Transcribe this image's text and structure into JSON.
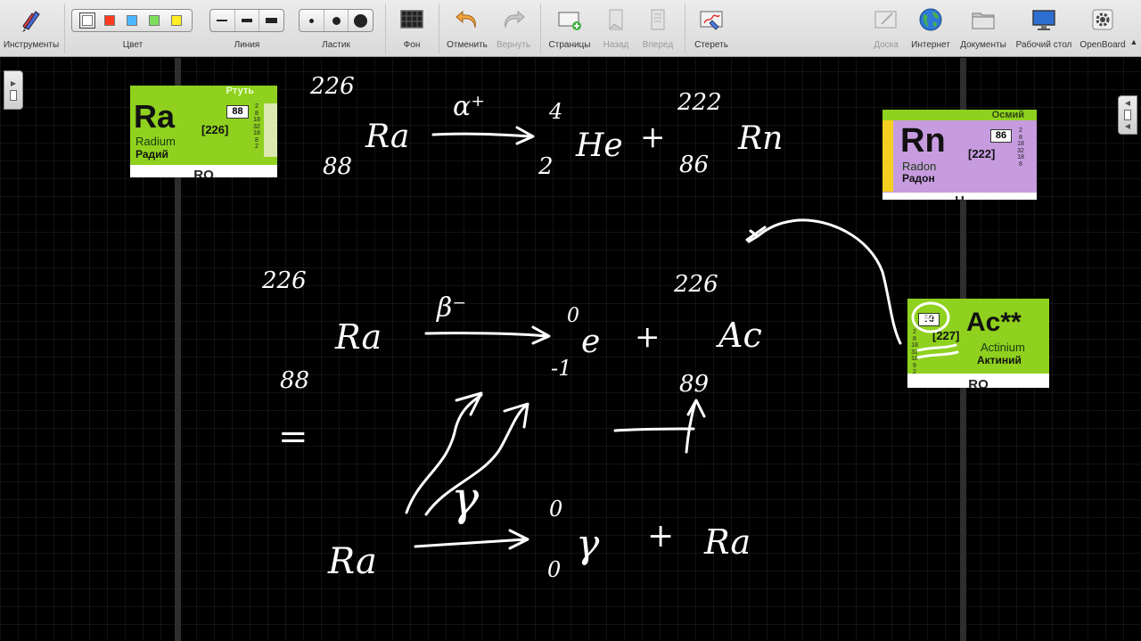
{
  "toolbar": {
    "tools_label": "Инструменты",
    "color_label": "Цвет",
    "line_label": "Линия",
    "eraser_label": "Ластик",
    "background_label": "Фон",
    "undo_label": "Отменить",
    "redo_label": "Вернуть",
    "pages_label": "Страницы",
    "back_label": "Назад",
    "forward_label": "Вперед",
    "clear_label": "Стереть",
    "board_label": "Доска",
    "internet_label": "Интернет",
    "documents_label": "Документы",
    "desktop_label": "Рабочий стол",
    "openboard_label": "OpenBoard",
    "colors": [
      "#ffffff",
      "#ff3b1f",
      "#4db8ff",
      "#7ee05a",
      "#ffee22"
    ],
    "selected_color_index": 0
  },
  "cards": {
    "ra": {
      "header": "Ртуть",
      "symbol": "Ra",
      "number": "88",
      "mass": "[226]",
      "name_en": "Radium",
      "name_ru": "Радий",
      "shells": "2\n8\n18\n32\n18\n8\n2",
      "footer": "RO",
      "color": "#8fd11e"
    },
    "rn": {
      "header": "Осмий",
      "symbol": "Rn",
      "number": "86",
      "mass": "[222]",
      "name_en": "Radon",
      "name_ru": "Радон",
      "shells": "2\n8\n18\n32\n18\n8",
      "footer": "H",
      "color": "#c79be0"
    },
    "ac": {
      "header": "",
      "symbol": "Ac**",
      "number": "89",
      "mass": "[227]",
      "name_en": "Actinium",
      "name_ru": "Актиний",
      "shells": "2\n8\n18\n32\n18\n9\n2",
      "footer": "RO",
      "color": "#8fd11e"
    }
  },
  "ink": {
    "eq1": {
      "mass_left": "226",
      "atomic_left": "88",
      "symbol_left": "Ra",
      "particle": "α⁺",
      "he_mass": "4",
      "he_atomic": "2",
      "he_symbol": "He",
      "plus": "+",
      "mass_right": "222",
      "atomic_right": "86",
      "symbol_right": "Rn"
    },
    "eq2": {
      "mass_left": "226",
      "atomic_left": "88",
      "symbol_left": "Ra",
      "particle": "β⁻",
      "e_mass": "0",
      "e_charge": "-1",
      "e_symbol": "e",
      "plus": "+",
      "mass_right": "226",
      "atomic_right": "89",
      "symbol_right": "Ac",
      "equals": "=",
      "gamma_note": "γ"
    },
    "eq3": {
      "symbol_left": "Ra",
      "g_mass": "0",
      "g_atomic": "0",
      "g_symbol": "γ",
      "plus": "+",
      "symbol_right": "Ra"
    },
    "circled_number": "89"
  }
}
